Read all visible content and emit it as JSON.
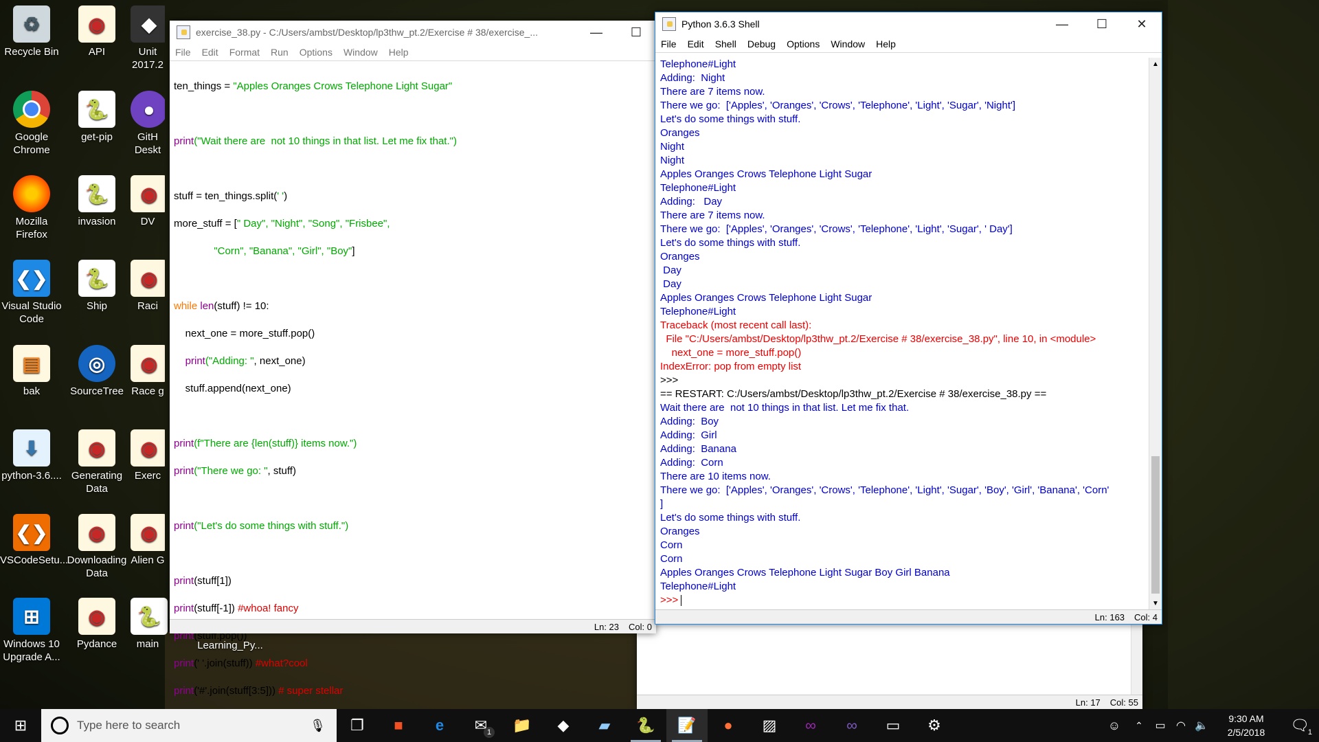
{
  "desktop": {
    "icons": [
      {
        "label": "Recycle Bin"
      },
      {
        "label": "API"
      },
      {
        "label": "Unit 2017.2"
      },
      {
        "label": "Google Chrome"
      },
      {
        "label": "get-pip"
      },
      {
        "label": "GitH Deskt"
      },
      {
        "label": "Mozilla Firefox"
      },
      {
        "label": "invasion"
      },
      {
        "label": "DV"
      },
      {
        "label": "Visual Studio Code"
      },
      {
        "label": "Ship"
      },
      {
        "label": "Raci"
      },
      {
        "label": "bak"
      },
      {
        "label": "SourceTree"
      },
      {
        "label": "Race g"
      },
      {
        "label": "python-3.6...."
      },
      {
        "label": "Generating Data"
      },
      {
        "label": "Exerc"
      },
      {
        "label": "VSCodeSetu..."
      },
      {
        "label": "Downloading Data"
      },
      {
        "label": "Alien G"
      },
      {
        "label": "Windows 10 Upgrade A..."
      },
      {
        "label": "Pydance"
      },
      {
        "label": "main"
      },
      {
        "label": "Learning_Py..."
      }
    ]
  },
  "editor": {
    "title": "exercise_38.py - C:/Users/ambst/Desktop/lp3thw_pt.2/Exercise # 38/exercise_...",
    "menu": [
      "File",
      "Edit",
      "Format",
      "Run",
      "Options",
      "Window",
      "Help"
    ],
    "lines": [
      {
        "p1": "ten_things = ",
        "p2": "\"Apples Oranges Crows Telephone Light Sugar\""
      },
      {
        "p1": "",
        "p2": ""
      },
      {
        "p1": "print",
        "p2": "(\"Wait there are  not 10 things in that list. Let me fix that.\")"
      },
      {
        "p1": "",
        "p2": ""
      },
      {
        "p1": "stuff = ten_things.split(",
        "p2": "' '",
        "p3": ")"
      },
      {
        "p1": "more_stuff = [",
        "p2": "\" Day\", \"Night\", \"Song\", \"Frisbee\","
      },
      {
        "p1": "              ",
        "p2": "\"Corn\", \"Banana\", \"Girl\", \"Boy\"",
        "p3": "]"
      },
      {
        "p1": "",
        "p2": ""
      },
      {
        "p1": "while",
        "p2": " len",
        "p3": "(stuff) != 10:"
      },
      {
        "p1": "    next_one = more_stuff.pop()",
        "p2": ""
      },
      {
        "p1": "    print",
        "p2": "(\"Adding: \"",
        "p3": ", next_one)"
      },
      {
        "p1": "    stuff.append(next_one)",
        "p2": ""
      },
      {
        "p1": "",
        "p2": ""
      },
      {
        "p1": "print",
        "p2": "(f\"There are {len(stuff)} items now.\")"
      },
      {
        "p1": "print",
        "p2": "(\"There we go: \"",
        "p3": ", stuff)"
      },
      {
        "p1": "",
        "p2": ""
      },
      {
        "p1": "print",
        "p2": "(\"Let's do some things with stuff.\")"
      },
      {
        "p1": "",
        "p2": ""
      },
      {
        "p1": "print",
        "p2": "(stuff[1])"
      },
      {
        "p1": "print",
        "p2": "(stuff[-1]) ",
        "p3": "#whoa! fancy"
      },
      {
        "p1": "print",
        "p2": "(stuff.pop())"
      },
      {
        "p1": "print",
        "p2": "(' '.join(stuff)) ",
        "p3": "#what?cool"
      },
      {
        "p1": "print",
        "p2": "('#'.join(stuff[3:5])) ",
        "p3": "# super stellar"
      }
    ],
    "status": {
      "ln": "Ln: 23",
      "col": "Col: 0"
    }
  },
  "shell": {
    "title": "Python 3.6.3 Shell",
    "menu": [
      "File",
      "Edit",
      "Shell",
      "Debug",
      "Options",
      "Window",
      "Help"
    ],
    "lines": [
      {
        "t": "Telephone#Light",
        "k": "out"
      },
      {
        "t": "Adding:  Night",
        "k": "out"
      },
      {
        "t": "There are 7 items now.",
        "k": "out"
      },
      {
        "t": "There we go:  ['Apples', 'Oranges', 'Crows', 'Telephone', 'Light', 'Sugar', 'Night']",
        "k": "out"
      },
      {
        "t": "Let's do some things with stuff.",
        "k": "out"
      },
      {
        "t": "Oranges",
        "k": "out"
      },
      {
        "t": "Night",
        "k": "out"
      },
      {
        "t": "Night",
        "k": "out"
      },
      {
        "t": "Apples Oranges Crows Telephone Light Sugar",
        "k": "out"
      },
      {
        "t": "Telephone#Light",
        "k": "out"
      },
      {
        "t": "Adding:   Day",
        "k": "out"
      },
      {
        "t": "There are 7 items now.",
        "k": "out"
      },
      {
        "t": "There we go:  ['Apples', 'Oranges', 'Crows', 'Telephone', 'Light', 'Sugar', ' Day']",
        "k": "out"
      },
      {
        "t": "Let's do some things with stuff.",
        "k": "out"
      },
      {
        "t": "Oranges",
        "k": "out"
      },
      {
        "t": " Day",
        "k": "out"
      },
      {
        "t": " Day",
        "k": "out"
      },
      {
        "t": "Apples Oranges Crows Telephone Light Sugar",
        "k": "out"
      },
      {
        "t": "Telephone#Light",
        "k": "out"
      },
      {
        "t": "Traceback (most recent call last):",
        "k": "err"
      },
      {
        "t": "  File \"C:/Users/ambst/Desktop/lp3thw_pt.2/Exercise # 38/exercise_38.py\", line 10, in <module>",
        "k": "err"
      },
      {
        "t": "    next_one = more_stuff.pop()",
        "k": "err"
      },
      {
        "t": "IndexError: pop from empty list",
        "k": "err"
      },
      {
        "t": ">>> ",
        "k": "std"
      },
      {
        "t": "== RESTART: C:/Users/ambst/Desktop/lp3thw_pt.2/Exercise # 38/exercise_38.py ==",
        "k": "std"
      },
      {
        "t": "Wait there are  not 10 things in that list. Let me fix that.",
        "k": "out"
      },
      {
        "t": "Adding:  Boy",
        "k": "out"
      },
      {
        "t": "Adding:  Girl",
        "k": "out"
      },
      {
        "t": "Adding:  Banana",
        "k": "out"
      },
      {
        "t": "Adding:  Corn",
        "k": "out"
      },
      {
        "t": "There are 10 items now.",
        "k": "out"
      },
      {
        "t": "There we go:  ['Apples', 'Oranges', 'Crows', 'Telephone', 'Light', 'Sugar', 'Boy', 'Girl', 'Banana', 'Corn'",
        "k": "out"
      },
      {
        "t": "]",
        "k": "out"
      },
      {
        "t": "Let's do some things with stuff.",
        "k": "out"
      },
      {
        "t": "Oranges",
        "k": "out"
      },
      {
        "t": "Corn",
        "k": "out"
      },
      {
        "t": "Corn",
        "k": "out"
      },
      {
        "t": "Apples Oranges Crows Telephone Light Sugar Boy Girl Banana",
        "k": "out"
      },
      {
        "t": "Telephone#Light",
        "k": "out"
      },
      {
        "t": ">>> ",
        "k": "err"
      }
    ],
    "status": {
      "ln": "Ln: 163",
      "col": "Col: 4"
    }
  },
  "back_window": {
    "status": {
      "ln": "Ln: 17",
      "col": "Col: 55"
    }
  },
  "taskbar": {
    "search_placeholder": "Type here to search",
    "time": "9:30 AM",
    "date": "2/5/2018",
    "mail_badge": "1",
    "notif_badge": "1"
  }
}
